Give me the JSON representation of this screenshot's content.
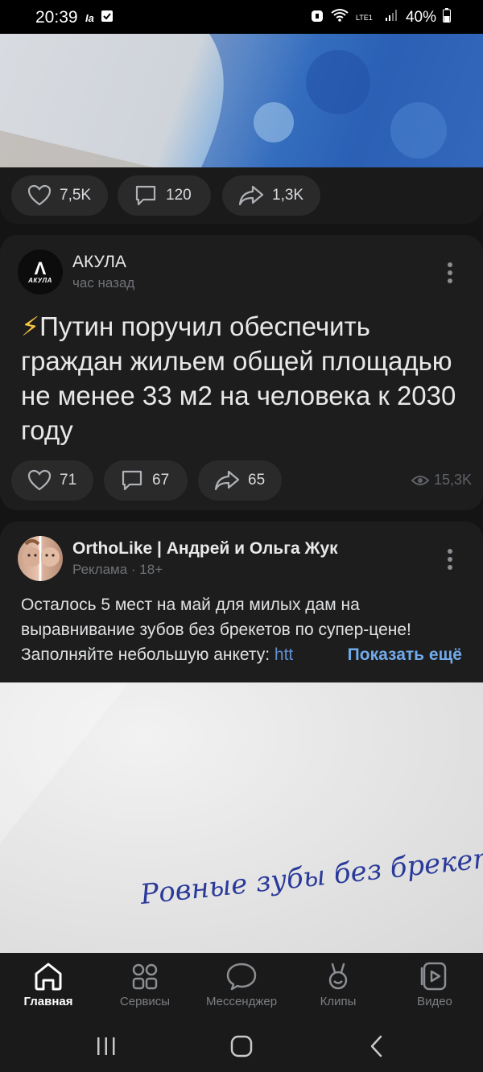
{
  "status_bar": {
    "time": "20:39",
    "notification_label": "Ia",
    "battery": "40%",
    "network": "LTE1"
  },
  "post1": {
    "likes": "7,5K",
    "comments": "120",
    "shares": "1,3K"
  },
  "post2": {
    "author": "АКУЛА",
    "avatar_label": "АКУЛА",
    "time": "час назад",
    "emoji": "⚡",
    "text": "Путин поручил обеспечить граждан жильем общей площадью не менее 33 м2 на человека к 2030 году",
    "likes": "71",
    "comments": "67",
    "shares": "65",
    "views": "15,3K"
  },
  "ad": {
    "author": "OrthoLike | Андрей и Ольга Жук",
    "label": "Реклама · 18+",
    "text": "Осталось 5 мест на май для милых дам на выравнивание зубов без брекетов по супер-цене! Заполняйте небольшую анкету: ",
    "link_fragment": "htt",
    "show_more": "Показать ещё",
    "handwriting": "Ровные зубы без брекетов?"
  },
  "tabs": [
    {
      "label": "Главная",
      "icon": "home-icon",
      "active": true
    },
    {
      "label": "Сервисы",
      "icon": "services-icon",
      "active": false
    },
    {
      "label": "Мессенджер",
      "icon": "messenger-icon",
      "active": false
    },
    {
      "label": "Клипы",
      "icon": "clips-icon",
      "active": false
    },
    {
      "label": "Видео",
      "icon": "video-icon",
      "active": false
    }
  ],
  "colors": {
    "background": "#141414",
    "card": "#1d1d1d",
    "pill": "#2a2a2a",
    "accent_link": "#71aaeb"
  }
}
